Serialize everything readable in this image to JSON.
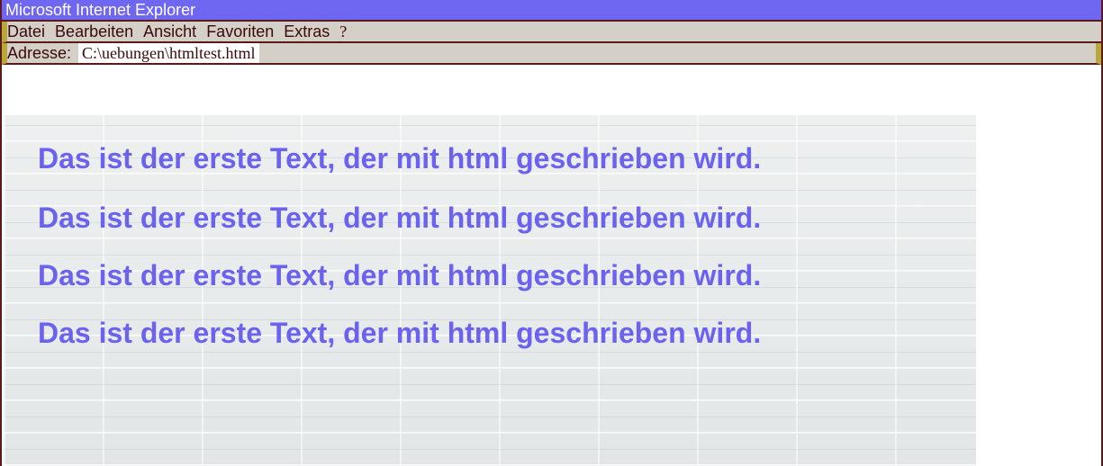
{
  "window": {
    "title": "Microsoft Internet Explorer"
  },
  "menubar": {
    "items": [
      "Datei",
      "Bearbeiten",
      "Ansicht",
      "Favoriten",
      "Extras",
      "?"
    ]
  },
  "address": {
    "label": "Adresse:",
    "value": "C:\\uebungen\\htmltest.html"
  },
  "content": {
    "lines": [
      "Das ist der erste Text, der mit html geschrieben wird.",
      "Das ist der erste Text, der mit html geschrieben wird.",
      "Das ist der erste Text, der mit html geschrieben wird.",
      "Das ist der erste Text, der mit html geschrieben wird."
    ]
  },
  "colors": {
    "title_bar": "#6f67f2",
    "title_text": "#ffffff",
    "chrome": "#d4d0c8",
    "accent_stripe": "#b8a83a",
    "frame_border": "#5a1a1a",
    "page_text": "#6b62f0"
  }
}
